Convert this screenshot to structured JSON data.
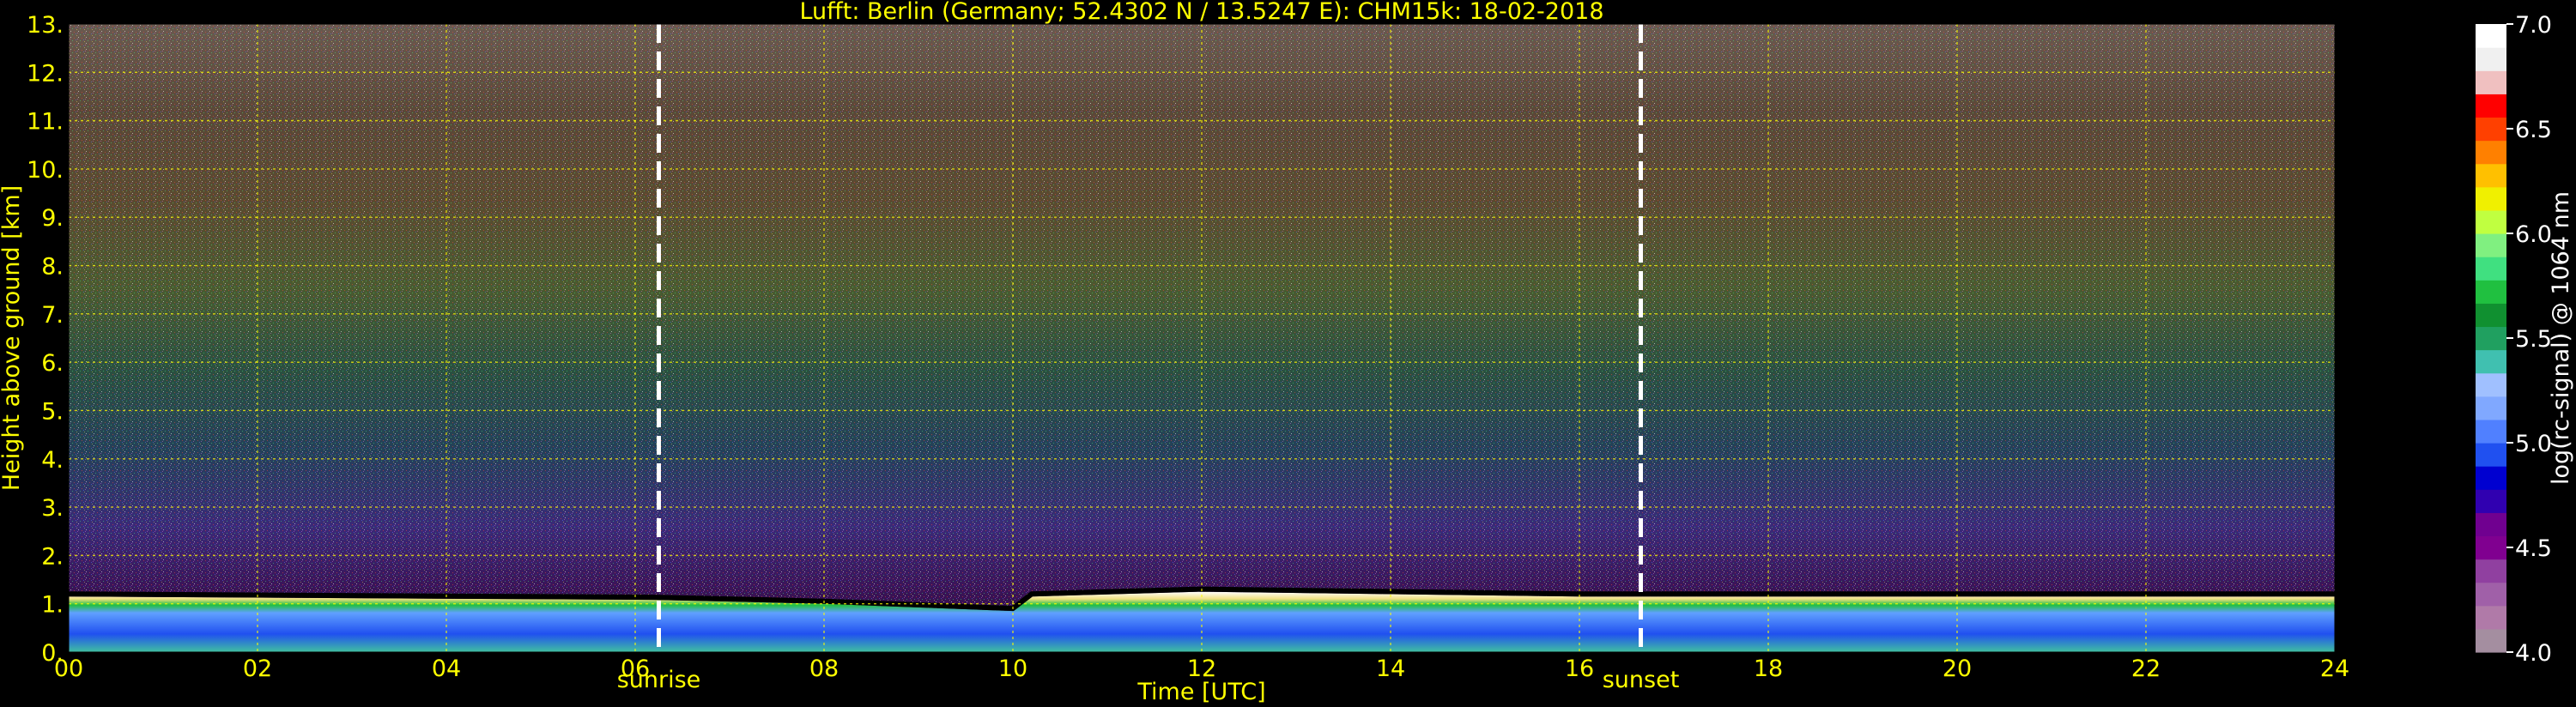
{
  "title": "Lufft: Berlin (Germany; 52.4302 N / 13.5247 E):    CHM15k: 18-02-2018",
  "colors": {
    "background": "#000000",
    "text": "#ffff00",
    "grid": "#ffff00",
    "marker_lines": "#ffffff"
  },
  "chart_data": {
    "type": "heatmap",
    "title": "Lufft: Berlin (Germany; 52.4302 N / 13.5247 E):    CHM15k: 18-02-2018",
    "xlabel": "Time [UTC]",
    "ylabel": "Height above ground [km]",
    "xlim": [
      0,
      24
    ],
    "ylim": [
      0,
      13
    ],
    "x_ticks": [
      0,
      2,
      4,
      6,
      8,
      10,
      12,
      14,
      16,
      18,
      20,
      22,
      24
    ],
    "x_tick_labels": [
      "00",
      "02",
      "04",
      "06",
      "08",
      "10",
      "12",
      "14",
      "16",
      "18",
      "20",
      "22",
      "24"
    ],
    "y_ticks": [
      0,
      1,
      2,
      3,
      4,
      5,
      6,
      7,
      8,
      9,
      10,
      11,
      12,
      13
    ],
    "y_tick_labels": [
      "0.",
      "1.",
      "2.",
      "3.",
      "4.",
      "5.",
      "6.",
      "7.",
      "8.",
      "9.",
      "10.",
      "11.",
      "12.",
      "13."
    ],
    "grid": true,
    "markers": [
      {
        "label": "sunrise",
        "x": 6.25
      },
      {
        "label": "sunset",
        "x": 16.65
      }
    ],
    "colorbar": {
      "label": "log(rc-signal) @ 1064 nm",
      "range": [
        4.0,
        7.0
      ],
      "ticks": [
        4.0,
        4.5,
        5.0,
        5.5,
        6.0,
        6.5,
        7.0
      ],
      "tick_labels": [
        "4.0",
        "4.5",
        "5.0",
        "5.5",
        "6.0",
        "6.5",
        "7.0"
      ],
      "colors": [
        "#a48ea0",
        "#b07aa8",
        "#a060a8",
        "#9040a0",
        "#800090",
        "#700090",
        "#3000b0",
        "#0000d0",
        "#2050f0",
        "#5080ff",
        "#80a8ff",
        "#a0c0ff",
        "#40c0b0",
        "#20a060",
        "#109030",
        "#20c040",
        "#40e080",
        "#80f080",
        "#c0ff40",
        "#f0f000",
        "#ffc000",
        "#ff8000",
        "#ff4000",
        "#ff0000",
        "#f0c0c0",
        "#f0f0f0",
        "#ffffff"
      ]
    },
    "boundary_layer_top_km": [
      {
        "x": 0,
        "y": 1.15
      },
      {
        "x": 6.25,
        "y": 1.08
      },
      {
        "x": 8,
        "y": 1.0
      },
      {
        "x": 10,
        "y": 0.85
      },
      {
        "x": 10.2,
        "y": 1.15
      },
      {
        "x": 12,
        "y": 1.25
      },
      {
        "x": 16,
        "y": 1.15
      },
      {
        "x": 24,
        "y": 1.15
      }
    ]
  }
}
